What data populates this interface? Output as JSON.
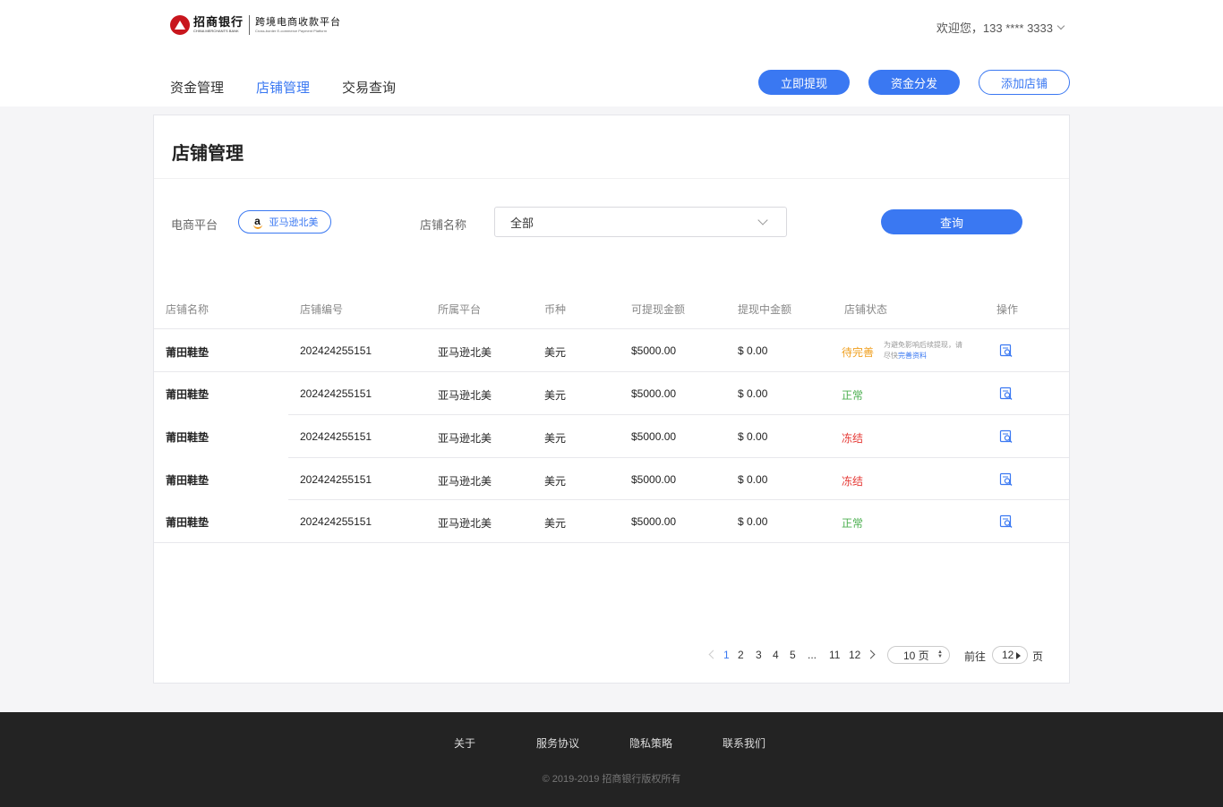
{
  "header": {
    "logo_cn": "招商银行",
    "logo_en": "CHINA MERCHANTS BANK",
    "platform_cn": "跨境电商收款平台",
    "platform_en": "Cross-border E-commerce Payment Platform",
    "welcome": "欢迎您，133 **** 3333"
  },
  "nav": {
    "items": [
      {
        "label": "资金管理",
        "active": false
      },
      {
        "label": "店铺管理",
        "active": true
      },
      {
        "label": "交易查询",
        "active": false
      }
    ]
  },
  "actions": {
    "withdraw": "立即提现",
    "distribute": "资金分发",
    "add_store": "添加店铺"
  },
  "card": {
    "title": "店铺管理"
  },
  "filters": {
    "platform_label": "电商平台",
    "platform_value": "亚马逊北美",
    "store_label": "店铺名称",
    "store_value": "全部",
    "search": "查询"
  },
  "table": {
    "headers": [
      "店铺名称",
      "店铺编号",
      "所属平台",
      "币种",
      "可提现金额",
      "提现中金额",
      "店铺状态",
      "操作"
    ],
    "rows": [
      {
        "name": "莆田鞋垫",
        "id": "202424255151",
        "platform": "亚马逊北美",
        "currency": "美元",
        "available": "$5000.00",
        "pending": "$ 0.00",
        "status": "待完善",
        "status_type": "pending"
      },
      {
        "name": "莆田鞋垫",
        "id": "202424255151",
        "platform": "亚马逊北美",
        "currency": "美元",
        "available": "$5000.00",
        "pending": "$ 0.00",
        "status": "正常",
        "status_type": "normal"
      },
      {
        "name": "莆田鞋垫",
        "id": "202424255151",
        "platform": "亚马逊北美",
        "currency": "美元",
        "available": "$5000.00",
        "pending": "$ 0.00",
        "status": "冻结",
        "status_type": "frozen"
      },
      {
        "name": "莆田鞋垫",
        "id": "202424255151",
        "platform": "亚马逊北美",
        "currency": "美元",
        "available": "$5000.00",
        "pending": "$ 0.00",
        "status": "冻结",
        "status_type": "frozen"
      },
      {
        "name": "莆田鞋垫",
        "id": "202424255151",
        "platform": "亚马逊北美",
        "currency": "美元",
        "available": "$5000.00",
        "pending": "$ 0.00",
        "status": "正常",
        "status_type": "normal"
      }
    ],
    "hint_text": "为避免影响后续提现，请尽快",
    "hint_link": "完善资料"
  },
  "pagination": {
    "pages": [
      "1",
      "2",
      "3",
      "4",
      "5",
      "...",
      "11",
      "12"
    ],
    "current": "1",
    "page_size": "10 页",
    "goto_label": "前往",
    "goto_value": "12",
    "page_unit": "页"
  },
  "footer": {
    "links": [
      "关于",
      "服务协议",
      "隐私策略",
      "联系我们"
    ],
    "copyright": "© 2019-2019  招商银行版权所有"
  },
  "colors": {
    "accent": "#3a78f2",
    "pending": "#f0a020",
    "normal": "#4caf50",
    "frozen": "#e53935",
    "footer_bg": "#232323"
  }
}
